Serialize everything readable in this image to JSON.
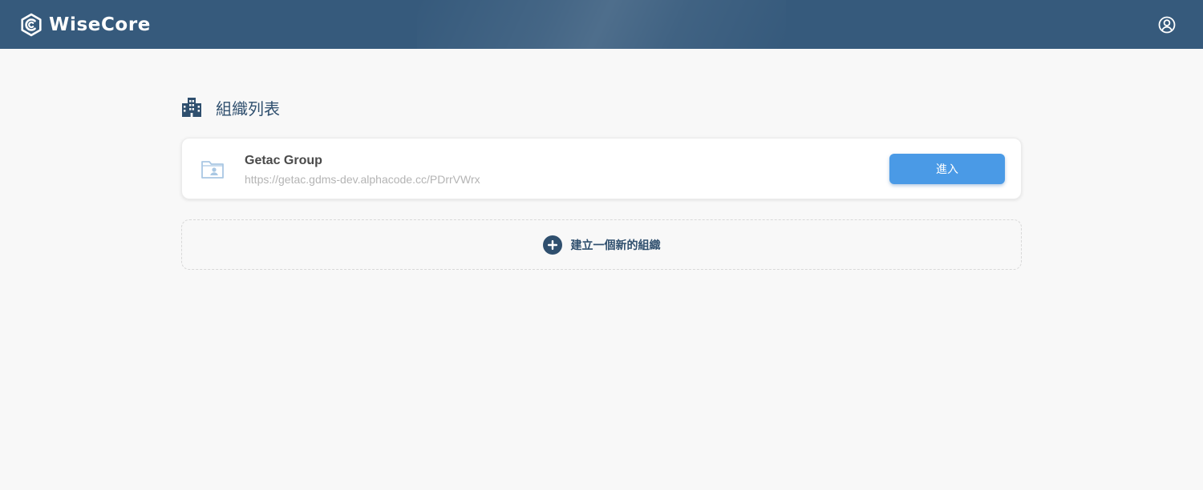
{
  "header": {
    "brand_name": "WiseCore",
    "logo_icon": "wisecore-logo-icon",
    "user_icon": "user-account-icon",
    "background_color": "#365a7c"
  },
  "page": {
    "title_icon": "building-icon",
    "title": "組織列表"
  },
  "organizations": [
    {
      "icon": "folder-contact-icon",
      "name": "Getac Group",
      "url": "https://getac.gdms-dev.alphacode.cc/PDrrVWrx",
      "enter_label": "進入"
    }
  ],
  "create": {
    "icon": "plus-circle-icon",
    "label": "建立一個新的組織"
  },
  "colors": {
    "accent": "#4a9ae6",
    "primary_dark": "#2f4f6e",
    "page_background": "#f8f8f8"
  }
}
